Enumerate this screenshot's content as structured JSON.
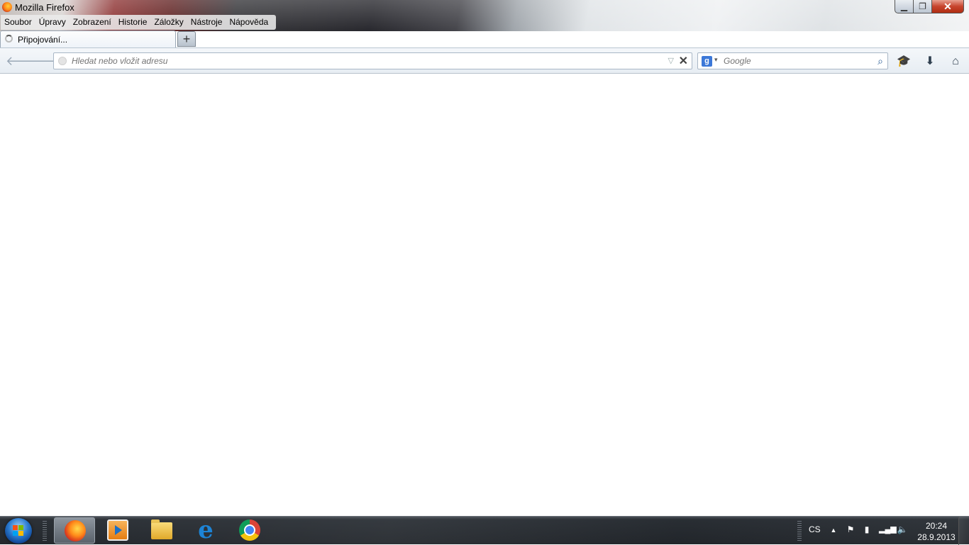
{
  "window": {
    "title": "Mozilla Firefox",
    "minimize_icon": "minimize-icon",
    "maximize_icon": "restore-icon",
    "close_icon": "close-icon"
  },
  "menubar": {
    "items": [
      "Soubor",
      "Úpravy",
      "Zobrazení",
      "Historie",
      "Záložky",
      "Nástroje",
      "Nápověda"
    ]
  },
  "tabs": [
    {
      "label": "Připojování...",
      "loading": true
    }
  ],
  "new_tab_label": "+",
  "navbar": {
    "url_placeholder": "Hledat nebo vložit adresu",
    "url_value": "",
    "search_engine": "Google",
    "search_placeholder": "Google"
  },
  "taskbar": {
    "pinned": [
      "firefox",
      "media-player",
      "file-explorer",
      "internet-explorer",
      "chrome"
    ],
    "language": "CS",
    "time": "20:24",
    "date": "28.9.2013"
  },
  "colors": {
    "accent": "#2d5f96",
    "taskbar": "#23272c",
    "close": "#c7442d"
  }
}
